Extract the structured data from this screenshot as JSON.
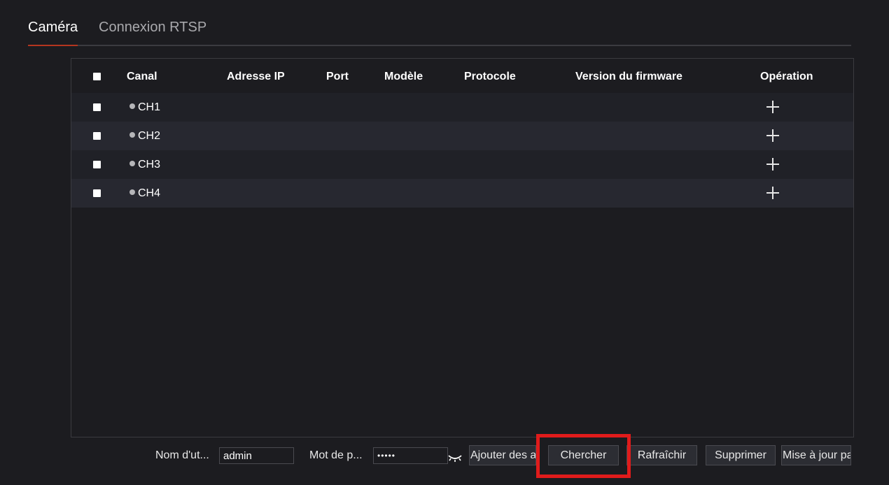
{
  "tabs": [
    {
      "label": "Caméra",
      "active": true
    },
    {
      "label": "Connexion RTSP",
      "active": false
    }
  ],
  "table": {
    "headers": [
      "Canal",
      "Adresse IP",
      "Port",
      "Modèle",
      "Protocole",
      "Version du firmware",
      "Opération"
    ],
    "rows": [
      {
        "channel": "CH1",
        "status_icon": "status-dot-icon",
        "operation_icon": "plus-icon"
      },
      {
        "channel": "CH2",
        "status_icon": "status-dot-icon",
        "operation_icon": "plus-icon"
      },
      {
        "channel": "CH3",
        "status_icon": "status-dot-icon",
        "operation_icon": "plus-icon"
      },
      {
        "channel": "CH4",
        "status_icon": "status-dot-icon",
        "operation_icon": "plus-icon"
      }
    ]
  },
  "bottom_bar": {
    "username_label": "Nom d'ut...",
    "username_value": "admin",
    "password_label": "Mot de p...",
    "password_value": "•••••",
    "password_toggle_icon": "eye-closed-icon",
    "buttons": {
      "add": "Ajouter des a",
      "search": "Chercher",
      "refresh": "Rafraîchir",
      "delete": "Supprimer",
      "update": "Mise à jour pa"
    }
  },
  "colors": {
    "background": "#1c1c20",
    "accent": "#b4361f",
    "highlight": "#e01b1b"
  }
}
